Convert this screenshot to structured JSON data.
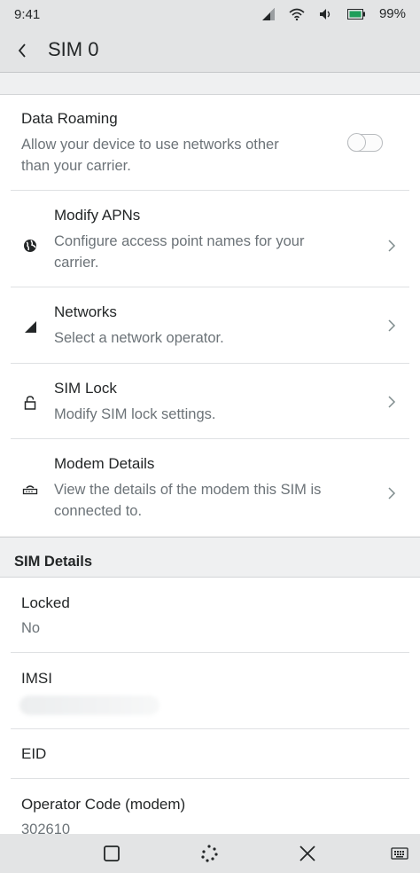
{
  "status_bar": {
    "time": "9:41",
    "battery_percent": "99%",
    "icons": [
      "signal-icon",
      "wifi-icon",
      "volume-icon",
      "battery-icon"
    ]
  },
  "header": {
    "back_icon": "back-arrow-icon",
    "title": "SIM 0"
  },
  "settings": {
    "data_roaming": {
      "label": "Data Roaming",
      "description_line1": "Allow your device to use networks other",
      "description_line2": "than your carrier.",
      "enabled": false
    },
    "modify_apns": {
      "icon": "globe-icon",
      "label": "Modify APNs",
      "description_line1": "Configure access point names for your",
      "description_line2": "carrier."
    },
    "networks": {
      "icon": "signal-strength-icon",
      "label": "Networks",
      "description": "Select a network operator."
    },
    "sim_lock": {
      "icon": "lock-icon",
      "label": "SIM Lock",
      "description": "Modify SIM lock settings."
    },
    "modem_details": {
      "icon": "modem-icon",
      "label": "Modem Details",
      "description_line1": "View the details of the modem this SIM is",
      "description_line2": "connected to."
    }
  },
  "sim_details": {
    "section_title": "SIM Details",
    "locked": {
      "label": "Locked",
      "value": "No"
    },
    "imsi": {
      "label": "IMSI"
    },
    "eid": {
      "label": "EID"
    },
    "operator_code": {
      "label": "Operator Code (modem)",
      "value": "302610"
    }
  },
  "nav_bar": {
    "buttons": [
      "overview-square-icon",
      "home-dots-icon",
      "close-icon",
      "keyboard-icon"
    ]
  },
  "colors": {
    "bar_background": "#e3e4e5",
    "card_background": "#ffffff",
    "secondary_text": "#6c7378",
    "primary_text": "#232627"
  }
}
